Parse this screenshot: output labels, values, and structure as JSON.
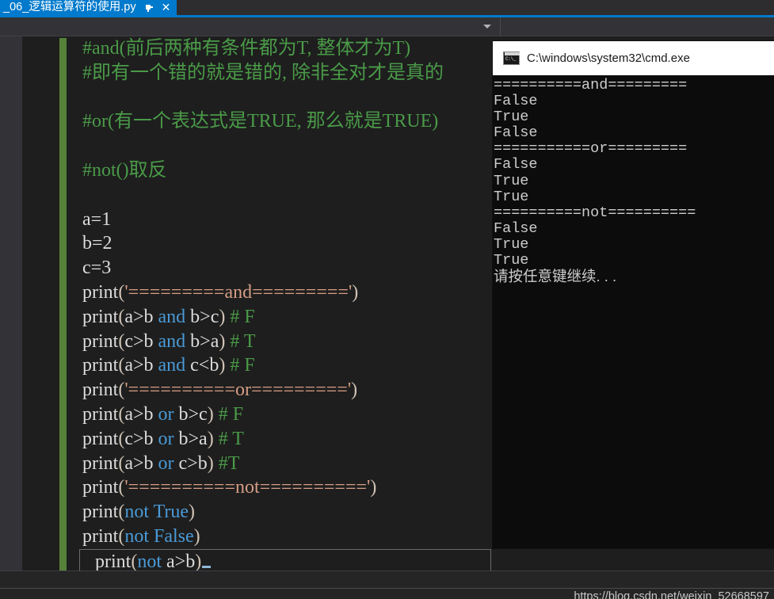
{
  "window": {
    "tab": {
      "title": "_06_逻辑运算符的使用.py",
      "pin_icon": "pin-icon",
      "close_icon": "close-icon",
      "active_color": "#007acc"
    },
    "navbar": {
      "left_value": "",
      "right_value": "",
      "caret_icon": "chevron-down-icon"
    }
  },
  "editor": {
    "colors": {
      "background": "#1e1e1e",
      "comment": "#4a9a48",
      "string": "#d69d85",
      "keyword": "#4a9ad6",
      "plain": "#dcdcdc",
      "changebar": "#57813a",
      "current_line_border": "#6b6b6b"
    },
    "lines": [
      {
        "type": "comment",
        "text": "#and(前后两种有条件都为T, 整体才为T)"
      },
      {
        "type": "comment",
        "text": "#即有一个错的就是错的, 除非全对才是真的"
      },
      {
        "type": "blank",
        "text": ""
      },
      {
        "type": "comment",
        "text": "#or(有一个表达式是TRUE, 那么就是TRUE)"
      },
      {
        "type": "blank",
        "text": ""
      },
      {
        "type": "comment",
        "text": "#not()取反"
      },
      {
        "type": "blank",
        "text": ""
      },
      {
        "type": "code",
        "text": "a=1"
      },
      {
        "type": "code",
        "text": "b=2"
      },
      {
        "type": "code",
        "text": "c=3"
      },
      {
        "type": "code",
        "text": "print('=========and=========')"
      },
      {
        "type": "code",
        "text": "print(a>b and b>c) # F"
      },
      {
        "type": "code",
        "text": "print(c>b and b>a) # T"
      },
      {
        "type": "code",
        "text": "print(a>b and c<b) # F"
      },
      {
        "type": "code",
        "text": "print('==========or=========')"
      },
      {
        "type": "code",
        "text": "print(a>b or b>c) # F"
      },
      {
        "type": "code",
        "text": "print(c>b or b>a) # T"
      },
      {
        "type": "code",
        "text": "print(a>b or c>b) #T"
      },
      {
        "type": "code",
        "text": "print('==========not==========')"
      },
      {
        "type": "code",
        "text": "print(not True)"
      },
      {
        "type": "code",
        "text": "print(not False)"
      },
      {
        "type": "code",
        "text": "print(not a>b)",
        "current": true
      }
    ],
    "tokens": {
      "print": "print",
      "kw_and": "and",
      "kw_or": "or",
      "kw_not": "not",
      "kw_true": "True",
      "kw_false": "False",
      "comment_F": "# F",
      "comment_T": "# T",
      "comment_T2": "#T",
      "str_and": "'=========and========='",
      "str_or": "'==========or========='",
      "str_not": "'==========not=========='",
      "var_a": "a=1",
      "var_b": "b=2",
      "var_c": "c=3"
    }
  },
  "console": {
    "title": "C:\\windows\\system32\\cmd.exe",
    "icon": "cmd-icon",
    "background": "#0c0c0c",
    "text_color": "#cccccc",
    "lines": [
      "==========and=========",
      "False",
      "True",
      "False",
      "===========or=========",
      "False",
      "True",
      "True",
      "==========not==========",
      "False",
      "True",
      "True",
      "请按任意键继续. . ."
    ]
  },
  "statusbar": {
    "watermark": "https://blog.csdn.net/weixin_52668597"
  }
}
